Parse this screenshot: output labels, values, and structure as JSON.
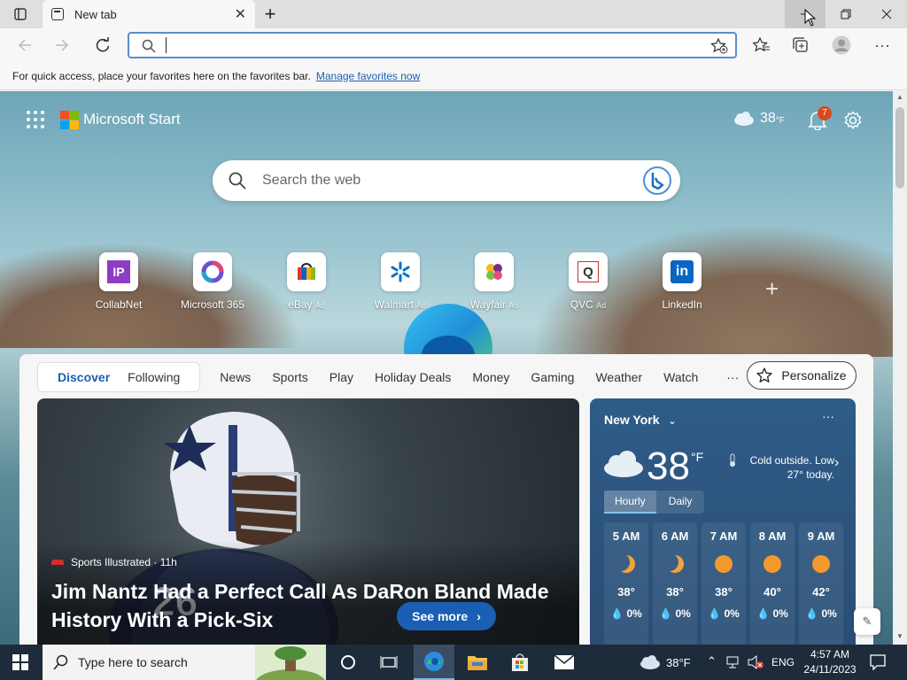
{
  "browser": {
    "tab_title": "New tab",
    "address_value": "",
    "favorites_bar": {
      "message": "For quick access, place your favorites here on the favorites bar.",
      "link": "Manage favorites now"
    }
  },
  "header": {
    "brand": "Microsoft Start",
    "temperature": "38",
    "temperature_unit": "°F",
    "notification_count": "7"
  },
  "search": {
    "placeholder": "Search the web"
  },
  "quick_links": [
    {
      "label": "CollabNet",
      "ad": "",
      "icon": "IP"
    },
    {
      "label": "Microsoft 365",
      "ad": "",
      "icon": ""
    },
    {
      "label": "eBay",
      "ad": "Ad",
      "icon": ""
    },
    {
      "label": "Walmart",
      "ad": "Ad",
      "icon": ""
    },
    {
      "label": "Wayfair",
      "ad": "Ad",
      "icon": ""
    },
    {
      "label": "QVC",
      "ad": "Ad",
      "icon": "Q"
    },
    {
      "label": "LinkedIn",
      "ad": "",
      "icon": "in"
    }
  ],
  "feed": {
    "tabs": [
      "Discover",
      "Following"
    ],
    "nav": [
      "News",
      "Sports",
      "Play",
      "Holiday Deals",
      "Money",
      "Gaming",
      "Weather",
      "Watch"
    ],
    "more": "···",
    "personalize": "Personalize"
  },
  "hero": {
    "source": "Sports Illustrated · 11h",
    "headline": "Jim Nantz Had a Perfect Call As DaRon Bland Made History With a Pick-Six",
    "cta": "See more",
    "jersey_number": "26"
  },
  "weather": {
    "city": "New York",
    "temperature": "38",
    "unit": "°F",
    "description": "Cold outside. Low 27° today.",
    "tabs": [
      "Hourly",
      "Daily"
    ],
    "hours": [
      {
        "time": "5 AM",
        "temp": "38°",
        "precip": "0%",
        "icon": "moon"
      },
      {
        "time": "6 AM",
        "temp": "38°",
        "precip": "0%",
        "icon": "moon"
      },
      {
        "time": "7 AM",
        "temp": "38°",
        "precip": "0%",
        "icon": "sun"
      },
      {
        "time": "8 AM",
        "temp": "40°",
        "precip": "0%",
        "icon": "sun"
      },
      {
        "time": "9 AM",
        "temp": "42°",
        "precip": "0%",
        "icon": "sun"
      }
    ]
  },
  "taskbar": {
    "search_placeholder": "Type here to search",
    "weather": "38°F",
    "language": "ENG",
    "time": "4:57 AM",
    "date": "24/11/2023"
  }
}
